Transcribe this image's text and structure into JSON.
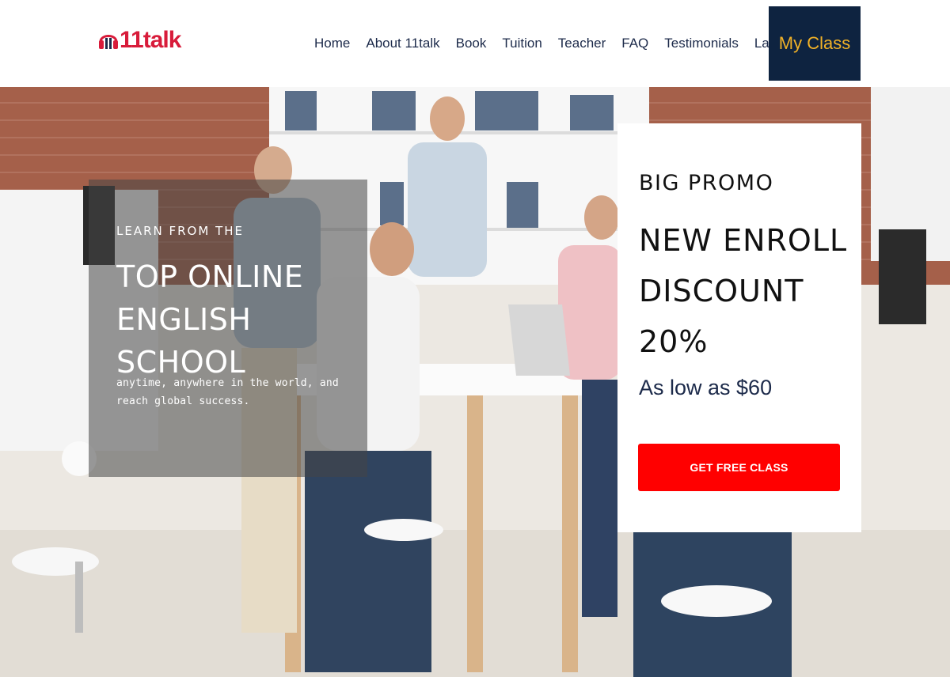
{
  "header": {
    "logo_text": "11talk",
    "logo_icon": "headset-icon",
    "nav": [
      {
        "label": "Home"
      },
      {
        "label": "About 11talk"
      },
      {
        "label": "Book"
      },
      {
        "label": "Tuition"
      },
      {
        "label": "Teacher"
      },
      {
        "label": "FAQ"
      },
      {
        "label": "Testimonials"
      },
      {
        "label": "Languages"
      }
    ],
    "cta_label": "My Class"
  },
  "hero": {
    "eyebrow": "LEARN FROM THE",
    "title": "TOP ONLINE ENGLISH SCHOOL",
    "subtitle": "anytime, anywhere in the world, and reach global success."
  },
  "promo": {
    "kicker": "BIG PROMO",
    "headline": "NEW ENROLL DISCOUNT 20%",
    "price": "As low as $60",
    "button_label": "GET FREE CLASS"
  },
  "colors": {
    "brand_red": "#d81b3a",
    "nav_text": "#1c2a4a",
    "cta_bg": "#0e2340",
    "cta_text": "#f2b227",
    "button_red": "#ff0000"
  }
}
